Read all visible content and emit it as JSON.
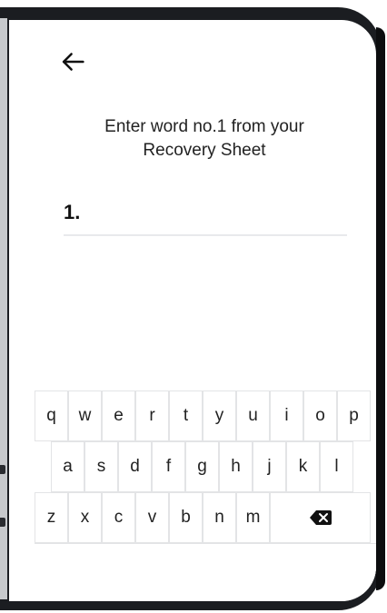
{
  "screen": {
    "prompt_line1": "Enter word no.1 from your",
    "prompt_line2": "Recovery Sheet",
    "field": {
      "number_label": "1.",
      "value": "",
      "placeholder": ""
    }
  },
  "icons": {
    "back": "arrow-left-icon",
    "backspace": "backspace-icon"
  },
  "keyboard": {
    "row1": [
      "q",
      "w",
      "e",
      "r",
      "t",
      "y",
      "u",
      "i",
      "o",
      "p"
    ],
    "row2": [
      "a",
      "s",
      "d",
      "f",
      "g",
      "h",
      "j",
      "k",
      "l"
    ],
    "row3": [
      "z",
      "x",
      "c",
      "v",
      "b",
      "n",
      "m"
    ]
  },
  "colors": {
    "frame": "#1b1d21",
    "text": "#222222",
    "divider": "#e8e9ec"
  }
}
